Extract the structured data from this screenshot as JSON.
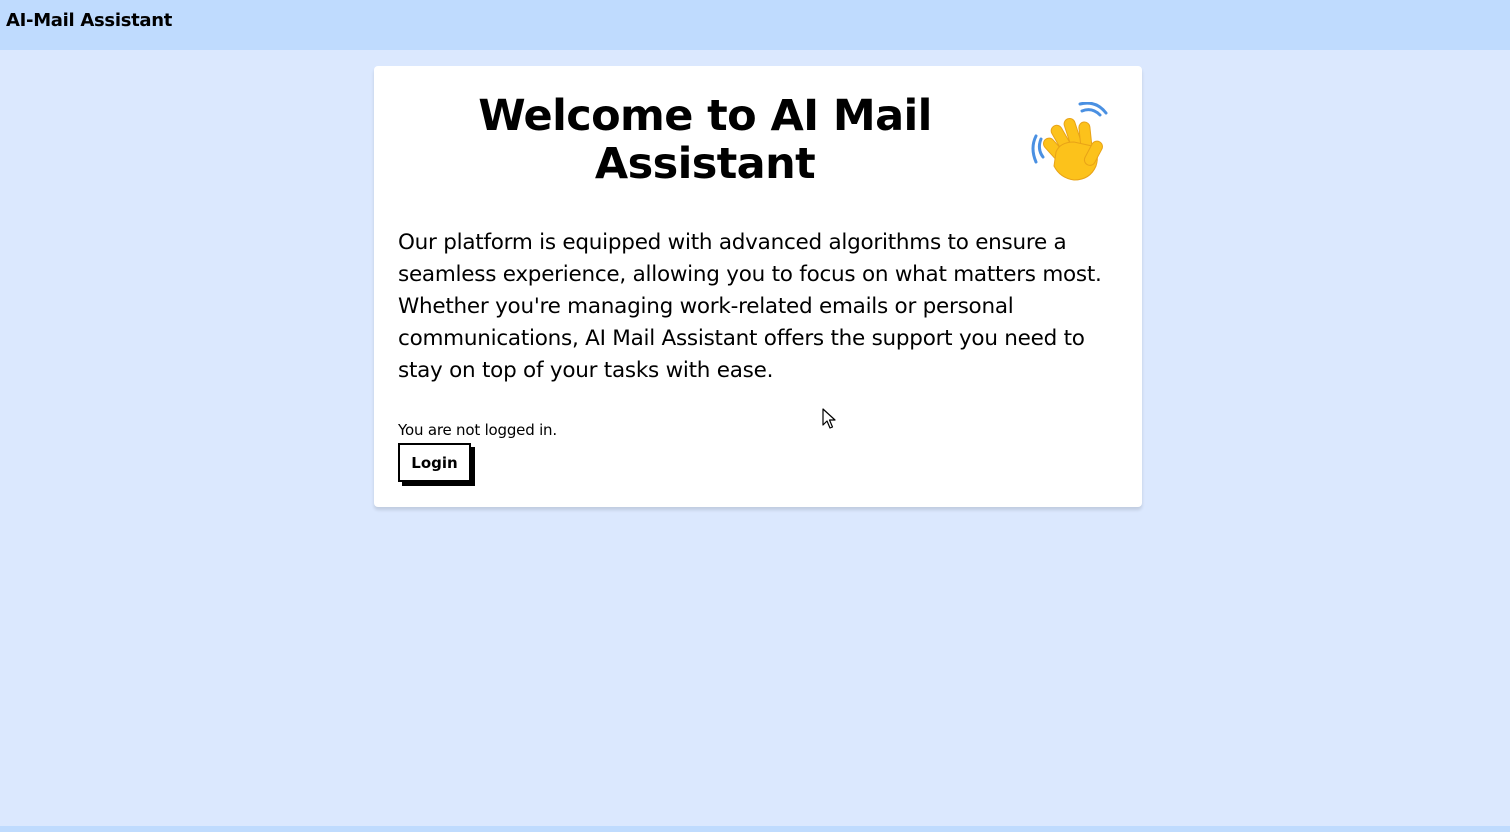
{
  "header": {
    "app_title": "AI-Mail Assistant"
  },
  "main": {
    "title": "Welcome to AI Mail Assistant",
    "title_icon": "waving-hand-icon",
    "description": "Our platform is equipped with advanced algorithms to ensure a seamless experience, allowing you to focus on what matters most. Whether you're managing work-related emails or personal communications, AI Mail Assistant offers the support you need to stay on top of your tasks with ease.",
    "login_status": "You are not logged in.",
    "login_button_label": "Login"
  },
  "colors": {
    "page_background": "#dbe8fe",
    "header_background": "#bfdbfe",
    "card_background": "#ffffff",
    "text": "#000000",
    "wave_hand": "#fcc21b",
    "wave_lines": "#4a90e2"
  }
}
